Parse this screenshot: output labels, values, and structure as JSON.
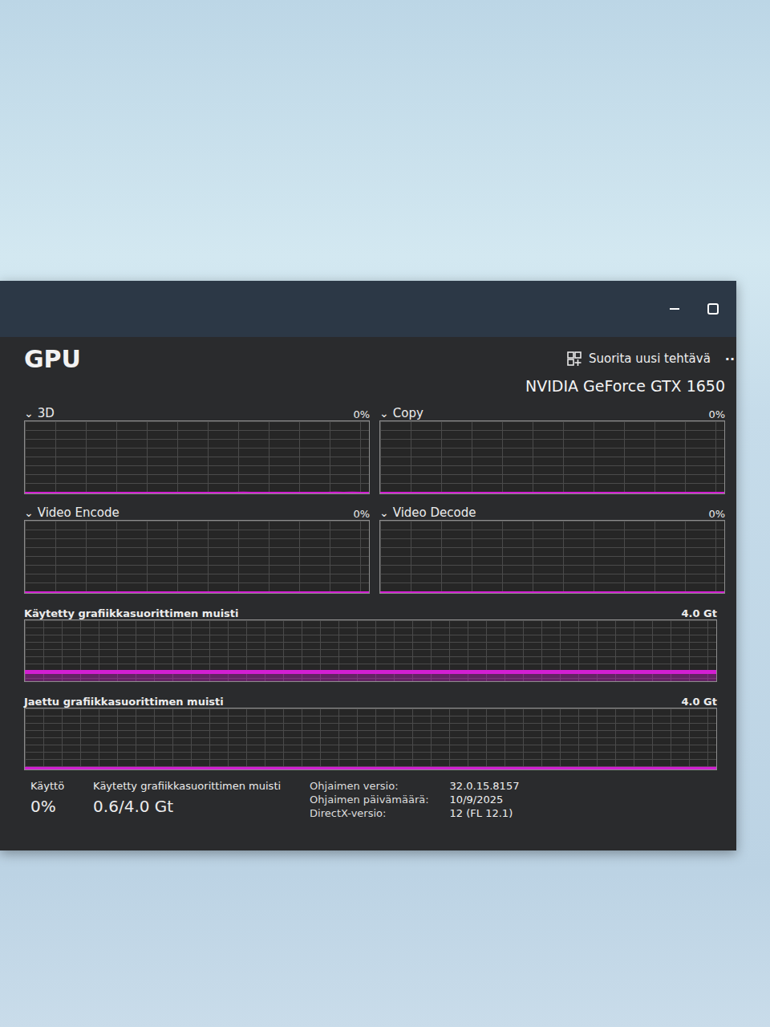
{
  "page": {
    "title": "GPU",
    "device": "NVIDIA GeForce GTX 1650"
  },
  "toolbar": {
    "run_task": "Suorita uusi tehtävä",
    "more": "··"
  },
  "engines": [
    {
      "chevron": "⌄",
      "name": "3D",
      "reading": "0%",
      "max_value": 100,
      "values": [
        0,
        0,
        0,
        0,
        0,
        0,
        0,
        0,
        0,
        0,
        0,
        0,
        0,
        0,
        0,
        0,
        0,
        0,
        0,
        0,
        0,
        0,
        0,
        0,
        0,
        0,
        1.5,
        0,
        0,
        0,
        0,
        0,
        0,
        0,
        0,
        0,
        0,
        1.5,
        0,
        1.5,
        0,
        0
      ]
    },
    {
      "chevron": "⌄",
      "name": "Copy",
      "reading": "0%",
      "max_value": 100,
      "values": [
        0,
        0,
        0,
        0,
        0,
        0,
        0,
        0,
        0,
        0,
        0,
        0,
        0,
        0,
        0,
        0,
        0,
        0,
        0,
        0,
        0,
        0,
        0,
        0,
        0,
        0,
        0,
        0,
        0,
        0,
        0,
        0,
        0,
        0,
        0,
        0,
        0,
        0,
        0,
        0,
        0,
        0
      ]
    },
    {
      "chevron": "⌄",
      "name": "Video Encode",
      "reading": "0%",
      "max_value": 100,
      "values": [
        0,
        0,
        0,
        0,
        0,
        0,
        0,
        0,
        0,
        0,
        0,
        0,
        0,
        0,
        0,
        0,
        0,
        0,
        0,
        0,
        0,
        0,
        0,
        0,
        0,
        0,
        0,
        0,
        0,
        0,
        0,
        0,
        0,
        0,
        0,
        0,
        0,
        0,
        0,
        0,
        0,
        0
      ]
    },
    {
      "chevron": "⌄",
      "name": "Video Decode",
      "reading": "0%",
      "max_value": 100,
      "values": [
        0,
        0,
        0,
        0,
        0,
        0,
        0,
        0,
        0,
        0,
        0,
        0,
        0,
        0,
        0,
        0,
        0,
        0,
        0,
        0,
        0,
        0,
        0,
        0,
        0,
        0,
        0,
        0,
        0,
        0,
        0,
        0,
        0,
        0,
        0,
        0,
        0,
        0,
        0,
        0,
        0,
        0
      ]
    }
  ],
  "memory_charts": [
    {
      "label": "Käytetty grafiikkasuorittimen muisti",
      "max": "4.0 Gt",
      "max_value": 4.0,
      "level": 0.15,
      "values": [
        0.6,
        0.6,
        0.6,
        0.6,
        0.6,
        0.6,
        0.6,
        0.6,
        0.6,
        0.6,
        0.6,
        0.6,
        0.6,
        0.6,
        0.6,
        0.6,
        0.6,
        0.6,
        0.6,
        0.6,
        0.6,
        0.6,
        0.6,
        0.6,
        0.6,
        0.6,
        0.6,
        0.6,
        0.6,
        0.6
      ]
    },
    {
      "label": "Jaettu grafiikkasuorittimen muisti",
      "max": "4.0 Gt",
      "max_value": 4.0,
      "level": 0,
      "values": [
        0,
        0,
        0,
        0,
        0,
        0,
        0,
        0,
        0,
        0,
        0,
        0,
        0,
        0,
        0,
        0,
        0,
        0,
        0,
        0,
        0,
        0,
        0,
        0,
        0,
        0,
        0,
        0,
        0,
        0
      ]
    }
  ],
  "stats": [
    {
      "label": "Käyttö",
      "value": "0%"
    },
    {
      "label": "Käytetty grafiikkasuorittimen muisti",
      "value": "0.6/4.0 Gt"
    }
  ],
  "details": [
    {
      "label": "Ohjaimen versio:",
      "value": "32.0.15.8157"
    },
    {
      "label": "Ohjaimen päivämäärä:",
      "value": "10/9/2025"
    },
    {
      "label": "DirectX-versio:",
      "value": "12 (FL 12.1)"
    }
  ]
}
